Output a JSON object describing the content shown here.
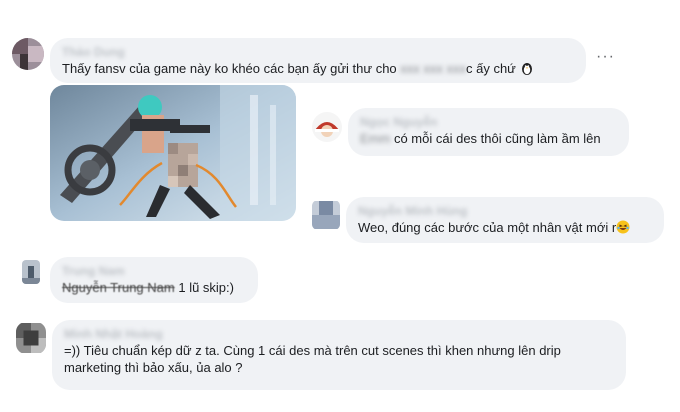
{
  "comments": [
    {
      "name": "Thảo Dung",
      "text_parts": [
        "Thấy fansv của game này ko khéo các bạn ấy gửi thư cho ",
        "xxx xxx xxx",
        "c ấy chứ "
      ],
      "emoji_icon": "penguin-emoji"
    },
    {
      "name": "Ngọc Nguyễn",
      "text_blur": "Emm",
      "text": " có mỗi cái des thôi cũng làm ầm lên"
    },
    {
      "name": "Nguyễn Minh Hùng",
      "text": "Weo, đúng các bước của một nhân vật mới r",
      "emoji_icon": "laughing-emoji"
    },
    {
      "name": "Trung Nam",
      "mention": "Nguyễn Trung Nam",
      "text": " 1 lũ skip:)"
    },
    {
      "name": "Minh Nhật Hoàng",
      "text": "=)) Tiêu chuẩn kép dữ z ta. Cùng 1 cái des mà trên cut scenes thì khen nhưng lên drip marketing thì bảo xấu, ủa alo ?"
    }
  ],
  "more_label": "···",
  "icons": {
    "more": "more-options-icon",
    "attachment": "game-character-image"
  },
  "colors": {
    "bubble": "#f0f2f5",
    "text": "#1c1e21",
    "muted": "#65676b"
  }
}
